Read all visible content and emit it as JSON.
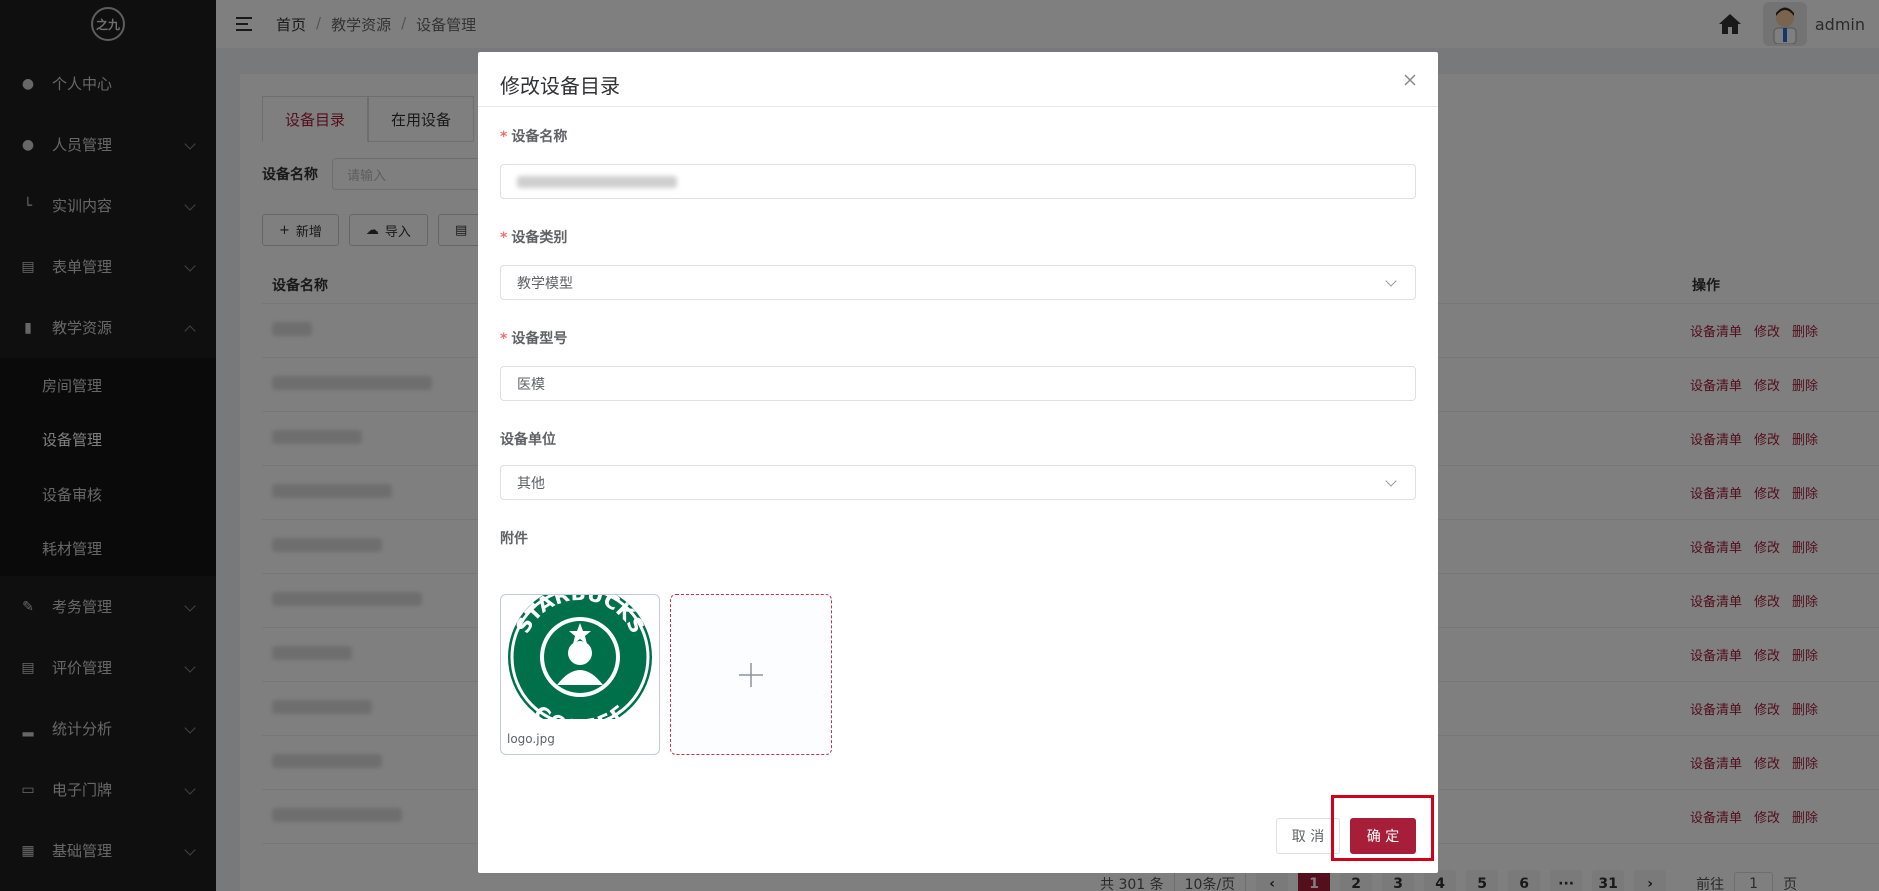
{
  "sidebar": {
    "logo_text": "之九",
    "items": [
      {
        "label": "个人中心",
        "icon": "user-icon"
      },
      {
        "label": "人员管理",
        "icon": "users-icon"
      },
      {
        "label": "实训内容",
        "icon": "tree-icon"
      },
      {
        "label": "表单管理",
        "icon": "form-icon"
      },
      {
        "label": "教学资源",
        "icon": "book-icon"
      },
      {
        "label": "考务管理",
        "icon": "edit-icon"
      },
      {
        "label": "评价管理",
        "icon": "review-icon"
      },
      {
        "label": "统计分析",
        "icon": "bar-chart-icon"
      },
      {
        "label": "电子门牌",
        "icon": "monitor-icon"
      },
      {
        "label": "基础管理",
        "icon": "grid-icon"
      }
    ],
    "submenu": [
      "房间管理",
      "设备管理",
      "设备审核",
      "耗材管理"
    ]
  },
  "header": {
    "breadcrumb": [
      "首页",
      "教学资源",
      "设备管理"
    ],
    "user": "admin"
  },
  "page": {
    "tabs": [
      "设备目录",
      "在用设备"
    ],
    "filter_label": "设备名称",
    "filter_placeholder": "请输入",
    "toolbar": [
      "新增",
      "导入"
    ],
    "columns": {
      "name": "设备名称",
      "ops": "操作"
    },
    "row_ops": [
      "设备清单",
      "修改",
      "删除"
    ],
    "pager": {
      "total": "共 301 条",
      "size": "10条/页",
      "pages": [
        "1",
        "2",
        "3",
        "4",
        "5",
        "6",
        "···",
        "31"
      ],
      "goto": "前往",
      "goto_value": "1",
      "goto_suffix": "页"
    }
  },
  "modal": {
    "title": "修改设备目录",
    "fields": {
      "name_label": "设备名称",
      "category_label": "设备类别",
      "category_value": "教学模型",
      "model_label": "设备型号",
      "model_value": "医模",
      "unit_label": "设备单位",
      "unit_value": "其他",
      "attachment_label": "附件"
    },
    "attachment": {
      "filename": "logo.jpg",
      "logo_top": "STARBUCKS",
      "logo_bottom": "COFFEE"
    },
    "cancel_label": "取 消",
    "ok_label": "确 定"
  },
  "colors": {
    "accent": "#a61e38",
    "sidebar_bg": "#1f1f1f",
    "starbucks_green": "#00704a"
  }
}
